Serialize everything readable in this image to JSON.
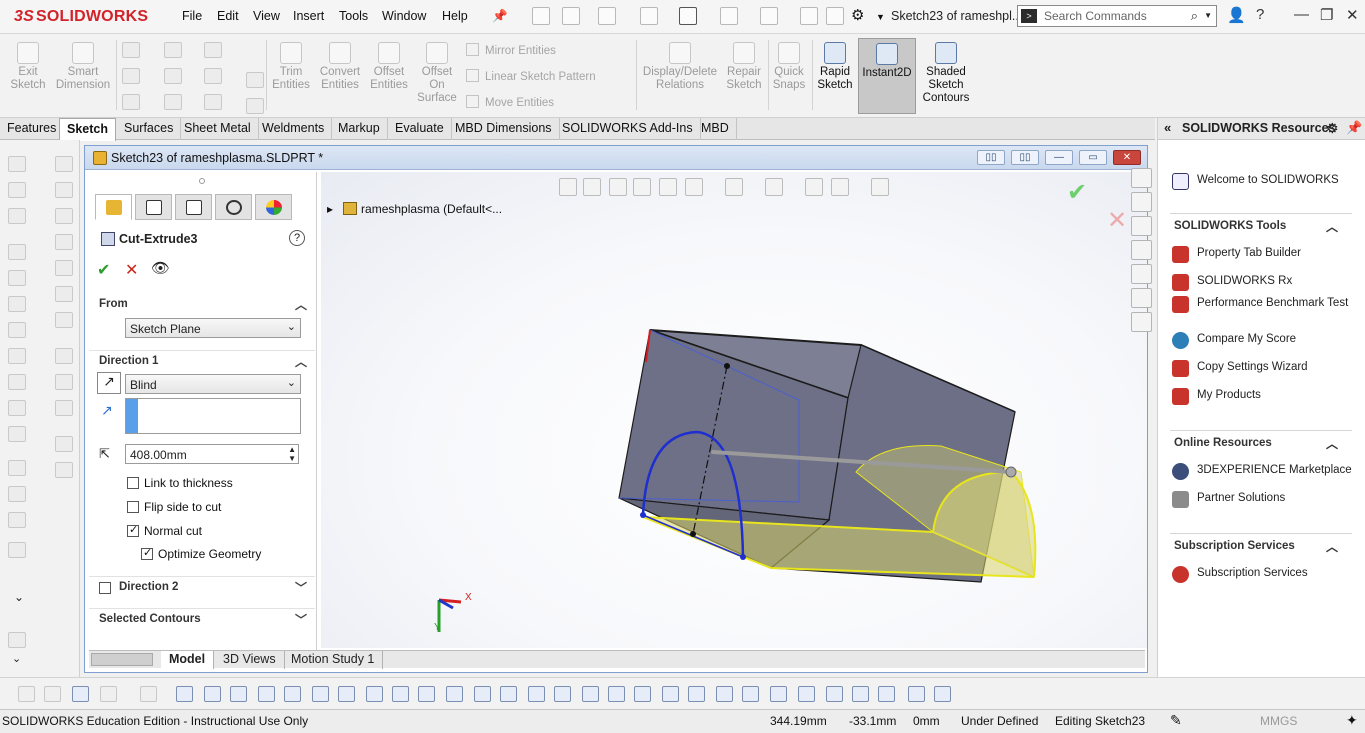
{
  "app": {
    "logo_prefix": "3S",
    "logo_text": "SOLIDWORKS"
  },
  "menu": [
    "File",
    "Edit",
    "View",
    "Insert",
    "Tools",
    "Window",
    "Help"
  ],
  "title_bar": {
    "document_title": "Sketch23 of rameshpl...",
    "search_placeholder": "Search Commands"
  },
  "ribbon": {
    "exit_sketch": "Exit Sketch",
    "smart_dimension": "Smart Dimension",
    "trim_entities": "Trim Entities",
    "convert_entities": "Convert Entities",
    "offset_entities": "Offset Entities",
    "offset_on_surface": "Offset On Surface",
    "mirror_entities": "Mirror Entities",
    "linear_sketch_pattern": "Linear Sketch Pattern",
    "move_entities": "Move Entities",
    "display_delete_relations": "Display/Delete Relations",
    "repair_sketch": "Repair Sketch",
    "quick_snaps": "Quick Snaps",
    "rapid_sketch": "Rapid Sketch",
    "instant2d": "Instant2D",
    "shaded_sketch_contours": "Shaded Sketch Contours"
  },
  "tabs": [
    "Features",
    "Sketch",
    "Surfaces",
    "Sheet Metal",
    "Weldments",
    "Markup",
    "Evaluate",
    "MBD Dimensions",
    "SOLIDWORKS Add-Ins",
    "MBD"
  ],
  "active_tab": "Sketch",
  "document": {
    "title": "Sketch23 of rameshplasma.SLDPRT *"
  },
  "property_manager": {
    "feature_name": "Cut-Extrude3",
    "help": "?",
    "from": {
      "label": "From",
      "value": "Sketch Plane"
    },
    "direction1": {
      "label": "Direction 1",
      "end_condition": "Blind",
      "depth": "408.00mm",
      "link_to_thickness": "Link to thickness",
      "flip_side_to_cut": "Flip side to cut",
      "normal_cut": "Normal cut",
      "optimize_geometry": "Optimize Geometry"
    },
    "direction2": {
      "label": "Direction 2"
    },
    "selected_contours": {
      "label": "Selected Contours"
    }
  },
  "feature_tree": {
    "root": "rameshplasma  (Default<..."
  },
  "model_tabs": [
    "Model",
    "3D Views",
    "Motion Study 1"
  ],
  "task_pane": {
    "title": "SOLIDWORKS Resources",
    "welcome": "Welcome to SOLIDWORKS",
    "groups": [
      {
        "title": "SOLIDWORKS Tools",
        "items": [
          "Property Tab Builder",
          "SOLIDWORKS Rx",
          "Performance Benchmark Test",
          "Compare My Score",
          "Copy Settings Wizard",
          "My Products"
        ]
      },
      {
        "title": "Online Resources",
        "items": [
          "3DEXPERIENCE Marketplace",
          "Partner Solutions"
        ]
      },
      {
        "title": "Subscription Services",
        "items": [
          "Subscription Services"
        ]
      }
    ]
  },
  "status_bar": {
    "edition": "SOLIDWORKS Education Edition - Instructional Use Only",
    "x": "344.19mm",
    "y": "-33.1mm",
    "z": "0mm",
    "state": "Under Defined",
    "editing": "Editing Sketch23",
    "units": "MMGS"
  },
  "triad": {
    "x": "X",
    "y": "Y"
  },
  "colors": {
    "accent_blue": "#1f2fcf",
    "preview_yellow": "#e8e51c",
    "brand_red": "#d2232a"
  }
}
